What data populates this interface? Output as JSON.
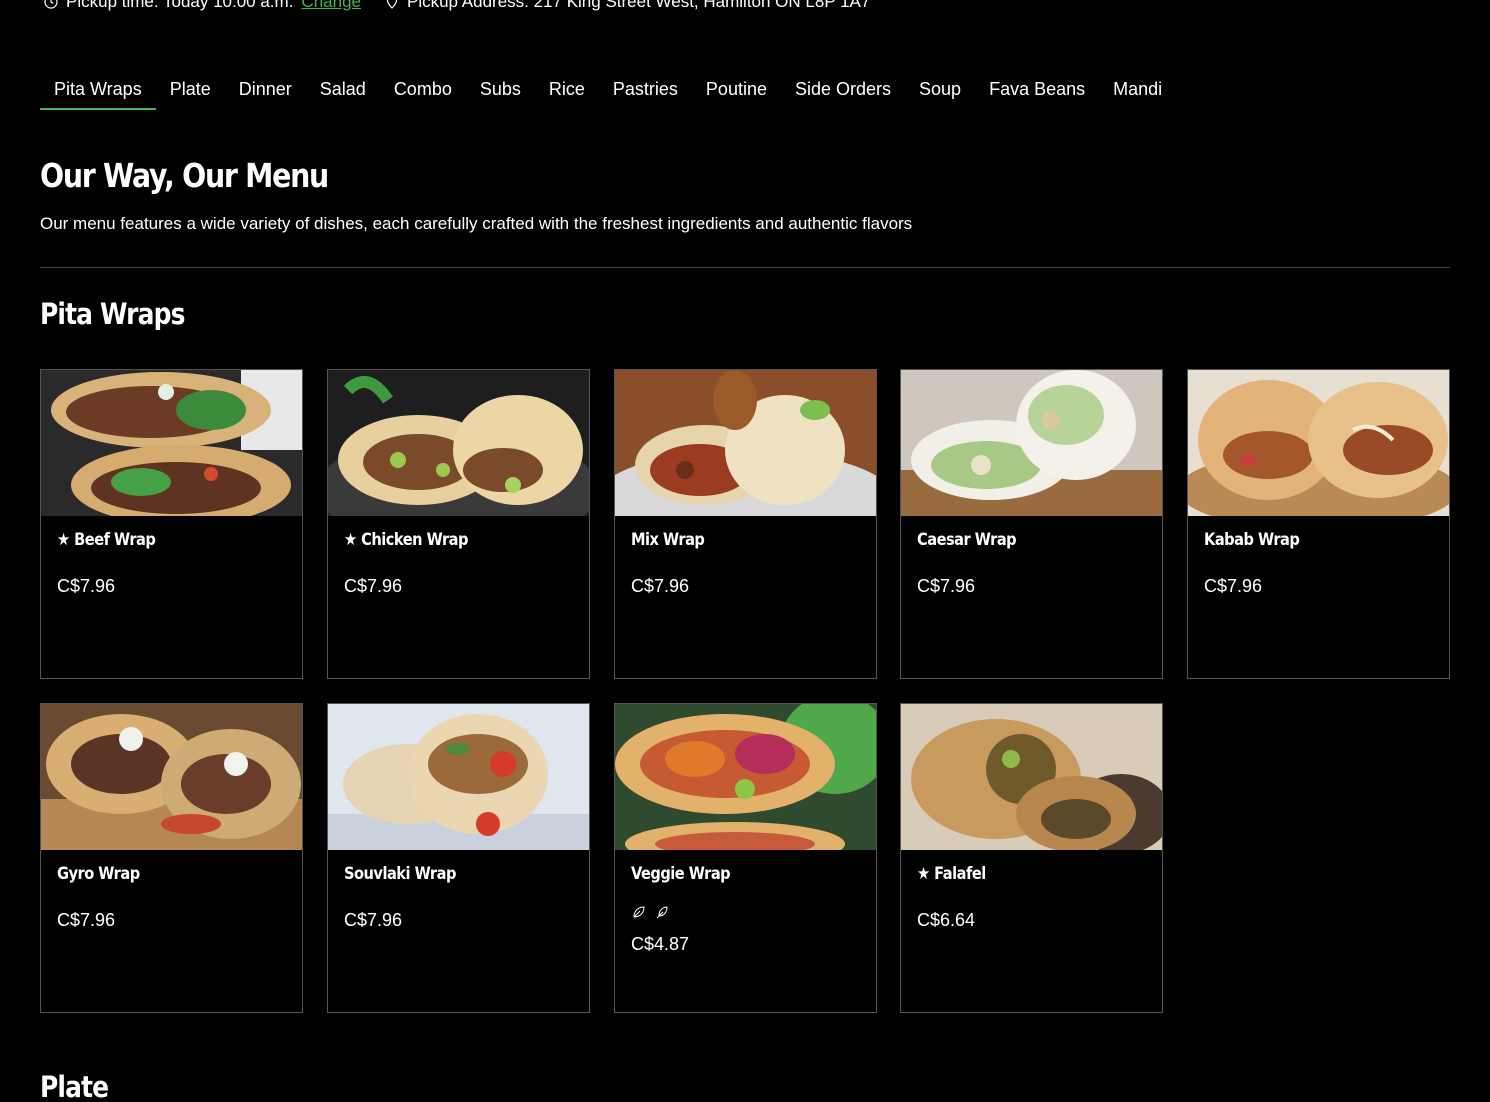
{
  "pickup": {
    "time_text": "Pickup time: Today 10:00 a.m.",
    "change_label": "Change",
    "address_text": "Pickup Address: 217 King Street West, Hamilton ON L8P 1A7"
  },
  "tabs": [
    {
      "label": "Pita Wraps",
      "active": true
    },
    {
      "label": "Plate"
    },
    {
      "label": "Dinner"
    },
    {
      "label": "Salad"
    },
    {
      "label": "Combo"
    },
    {
      "label": "Subs"
    },
    {
      "label": "Rice"
    },
    {
      "label": "Pastries"
    },
    {
      "label": "Poutine"
    },
    {
      "label": "Side Orders"
    },
    {
      "label": "Soup"
    },
    {
      "label": "Fava Beans"
    },
    {
      "label": "Mandi"
    }
  ],
  "hero": {
    "title": "Our Way, Our Menu",
    "description": "Our menu features a wide variety of dishes, each carefully crafted with the freshest ingredients and authentic flavors"
  },
  "sections": [
    {
      "title": "Pita Wraps",
      "items": [
        {
          "name": "★ Beef Wrap",
          "price": "C$7.96"
        },
        {
          "name": "★ Chicken Wrap",
          "price": "C$7.96"
        },
        {
          "name": "Mix Wrap",
          "price": "C$7.96"
        },
        {
          "name": "Caesar Wrap",
          "price": "C$7.96"
        },
        {
          "name": "Kabab Wrap",
          "price": "C$7.96"
        },
        {
          "name": "Gyro Wrap",
          "price": "C$7.96"
        },
        {
          "name": "Souvlaki Wrap",
          "price": "C$7.96"
        },
        {
          "name": "Veggie Wrap",
          "price": "C$4.87",
          "dietary_icons": [
            "vegetarian-leaf-icon",
            "vegan-leaf-icon"
          ]
        },
        {
          "name": "★ Falafel",
          "price": "C$6.64"
        }
      ]
    },
    {
      "title": "Plate"
    }
  ],
  "colors": {
    "accent": "#4caf50",
    "background": "#000000",
    "border": "#555555"
  }
}
